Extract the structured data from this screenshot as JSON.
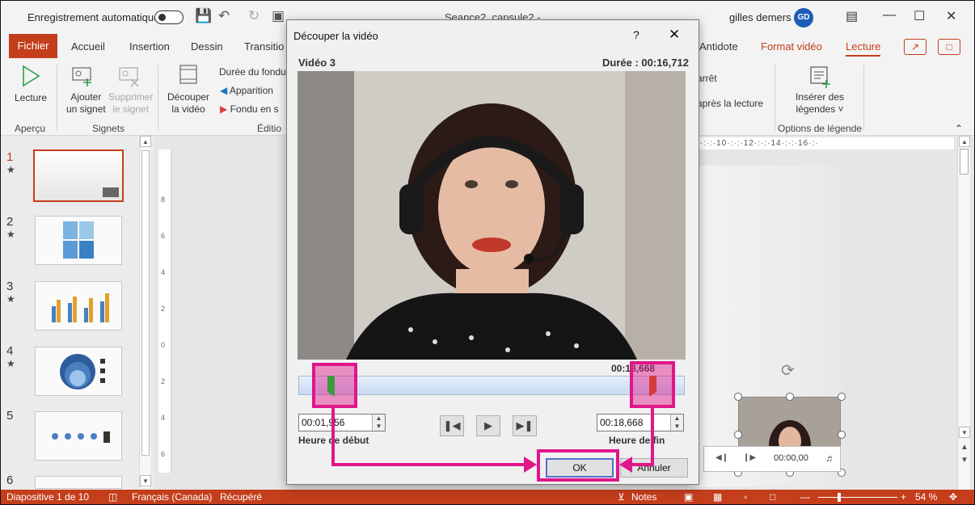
{
  "titlebar": {
    "autosave_label": "Enregistrement automatique",
    "doc_title": "Seance2_capsule2 -",
    "user_name": "gilles demers",
    "user_initials": "GD"
  },
  "tabs": {
    "fichier": "Fichier",
    "items": [
      "Accueil",
      "Insertion",
      "Dessin",
      "Transitio"
    ],
    "antidote": "Antidote",
    "format_video": "Format vidéo",
    "lecture": "Lecture"
  },
  "ribbon": {
    "lecture_btn": "Lecture",
    "apercu_group": "Aperçu",
    "ajouter_signet_1": "Ajouter",
    "ajouter_signet_2": "un signet",
    "supprimer_signet_1": "Supprimer",
    "supprimer_signet_2": "le signet",
    "signets_group": "Signets",
    "decouper_1": "Découper",
    "decouper_2": "la vidéo",
    "duree_fondu": "Durée du fondu",
    "apparition": "Apparition",
    "fondu_en": "Fondu en s",
    "edition_group": "Éditio",
    "arret": "arrêt",
    "apres_lecture": "après la lecture",
    "inserer_legendes_1": "Insérer des",
    "inserer_legendes_2": "légendes ˅",
    "options_legende_group": "Options de légende"
  },
  "slides": [
    {
      "num": "1",
      "star": "★"
    },
    {
      "num": "2",
      "star": "★"
    },
    {
      "num": "3",
      "star": "★"
    },
    {
      "num": "4",
      "star": "★"
    },
    {
      "num": "5",
      "star": ""
    },
    {
      "num": "6",
      "star": ""
    }
  ],
  "rulers": {
    "horizontal": "8·:·:·10·:·:·12·:·:·14·:·:·16·:·",
    "vertical_ticks": [
      "8",
      "6",
      "4",
      "2",
      "0",
      "2",
      "4",
      "6",
      "8"
    ]
  },
  "video_control": {
    "time": "00:00,00"
  },
  "statusbar": {
    "slide": "Diapositive 1 de 10",
    "language": "Français (Canada)",
    "recovered": "Récupéré",
    "notes": "Notes",
    "zoom": "54 %"
  },
  "dialog": {
    "title": "Découper la vidéo",
    "help": "?",
    "close": "✕",
    "video_name": "Vidéo 3",
    "duration": "Durée : 00:16,712",
    "current_time": "00:18,668",
    "start_time_value": "00:01,956",
    "end_time_value": "00:18,668",
    "start_label": "Heure de début",
    "end_label": "Heure de fin",
    "ok": "OK",
    "cancel": "Annuler"
  },
  "annotation": {
    "color": "#e0168a"
  }
}
